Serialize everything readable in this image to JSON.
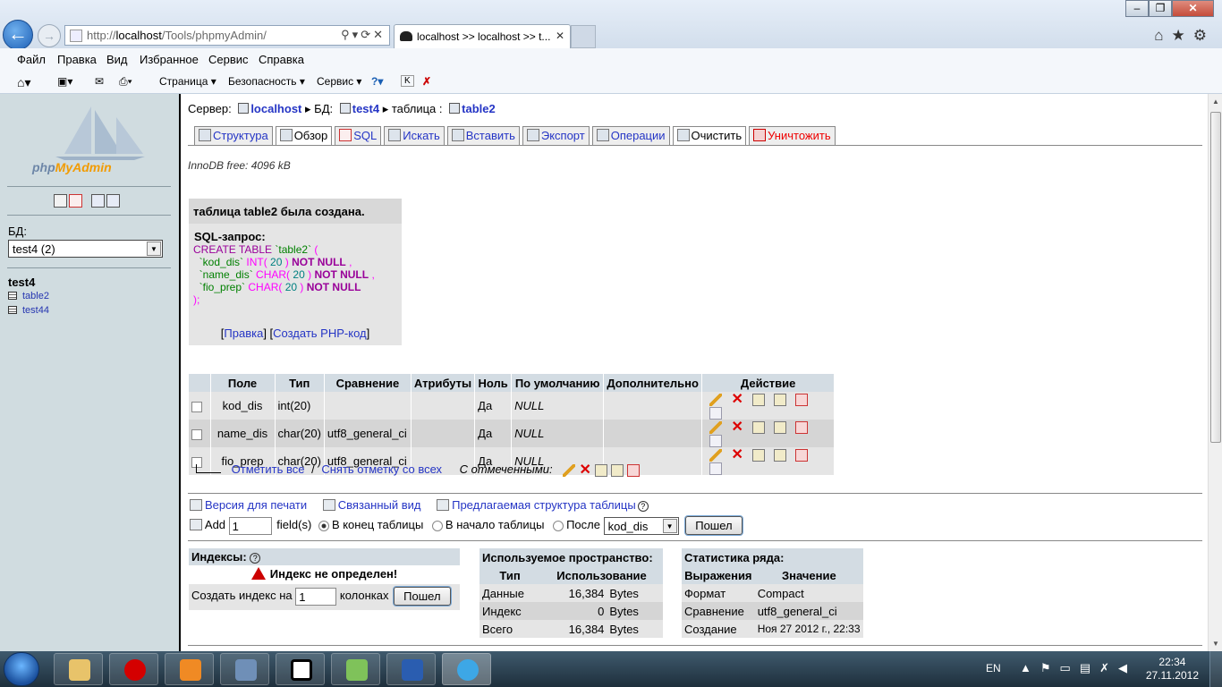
{
  "browser": {
    "url_prefix": "http://",
    "url_host": "localhost",
    "url_path": "/Tools/phpmyAdmin/",
    "tab_title": "localhost >> localhost >> t...",
    "menu": [
      "Файл",
      "Правка",
      "Вид",
      "Избранное",
      "Сервис",
      "Справка"
    ],
    "cmdbar": [
      "Страница ▾",
      "Безопасность ▾",
      "Сервис ▾"
    ]
  },
  "nav": {
    "logo_a": "php",
    "logo_b": "MyAdmin",
    "db_label": "БД:",
    "db_selected": "test4 (2)",
    "db_name": "test4",
    "tables": [
      "table2",
      "test44"
    ]
  },
  "breadcrumb": {
    "server_label": "Сервер:",
    "server": "localhost",
    "db_label": "БД:",
    "db": "test4",
    "table_label": "таблица :",
    "table": "table2"
  },
  "tabs": [
    "Структура",
    "Обзор",
    "SQL",
    "Искать",
    "Вставить",
    "Экспорт",
    "Операции",
    "Очистить",
    "Уничтожить"
  ],
  "innodb": "InnoDB free: 4096 kB",
  "message": {
    "title": "таблица table2 была создана.",
    "sql_label": "SQL-запрос:",
    "edit": "Правка",
    "php": "Создать PHP-код"
  },
  "structure": {
    "headers": [
      "Поле",
      "Тип",
      "Сравнение",
      "Атрибуты",
      "Ноль",
      "По умолчанию",
      "Дополнительно",
      "Действие"
    ],
    "rows": [
      {
        "field": "kod_dis",
        "type": "int(20)",
        "collation": "",
        "attributes": "",
        "null": "Да",
        "default": "NULL",
        "extra": ""
      },
      {
        "field": "name_dis",
        "type": "char(20)",
        "collation": "utf8_general_ci",
        "attributes": "",
        "null": "Да",
        "default": "NULL",
        "extra": ""
      },
      {
        "field": "fio_prep",
        "type": "char(20)",
        "collation": "utf8_general_ci",
        "attributes": "",
        "null": "Да",
        "default": "NULL",
        "extra": ""
      }
    ],
    "select_all": "Отметить все",
    "separator": "/",
    "unselect_all": "Снять отметку со всех",
    "with_selected": "С отмеченными:"
  },
  "links": {
    "print": "Версия для печати",
    "relation": "Связанный вид",
    "propose": "Предлагаемая структура таблицы"
  },
  "add_field": {
    "label": "Add",
    "count": "1",
    "fields": "field(s)",
    "at_end": "В конец таблицы",
    "at_begin": "В начало таблицы",
    "after": "После",
    "after_field": "kod_dis",
    "go": "Пошел"
  },
  "indexes": {
    "title": "Индексы:",
    "warning": "Индекс не определен!",
    "create_prefix": "Создать индекс на",
    "create_count": "1",
    "create_suffix": "колонках",
    "go": "Пошел"
  },
  "space": {
    "title": "Используемое пространство:",
    "headers": [
      "Тип",
      "Использование"
    ],
    "rows": [
      {
        "type": "Данные",
        "value": "16,384",
        "unit": "Bytes"
      },
      {
        "type": "Индекс",
        "value": "0",
        "unit": "Bytes"
      },
      {
        "type": "Всего",
        "value": "16,384",
        "unit": "Bytes"
      }
    ]
  },
  "stats": {
    "title": "Статистика ряда:",
    "headers": [
      "Выражения",
      "Значение"
    ],
    "rows": [
      {
        "k": "Формат",
        "v": "Compact"
      },
      {
        "k": "Сравнение",
        "v": "utf8_general_ci"
      },
      {
        "k": "Создание",
        "v": "Ноя 27 2012 г., 22:33"
      }
    ]
  },
  "taskbar": {
    "lang": "EN",
    "time": "22:34",
    "date": "27.11.2012"
  }
}
